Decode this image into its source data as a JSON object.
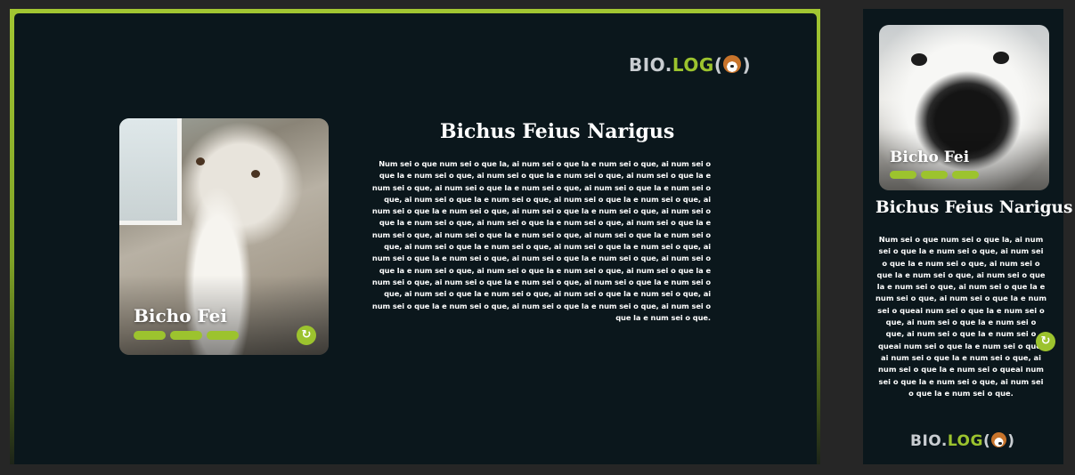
{
  "brand": {
    "bio": "BIO.",
    "log": "LOG",
    "open_paren": "(",
    "close_paren": ")",
    "emoji_icon": "dog-face-icon",
    "accent_color": "#9cc32e"
  },
  "desktop": {
    "card": {
      "pet_name": "Bicho Fei",
      "level_bars": 3,
      "refresh_icon": "refresh-icon"
    },
    "scientific_name": "Bichus Feius Narigus",
    "description": "Num sei o que num sei o que la, ai num sei o que la e num sei o que, ai num sei o que la e num sei o que, ai num sei o que la e num sei o que, ai num sei o que la e num sei o que, ai num sei o que la e num sei o que, ai num sei o que la e num sei o que, ai num sei o que la e num sei o que, ai num sei o que la e num sei o que, ai num sei o que la e num sei o que, ai num sei o que la e num sei o que, ai num sei o que la e num sei o que, ai num sei o que la e num sei o que, ai num sei o que la e num sei o que, ai num sei o que la e num sei o que, ai num sei o que la e num sei o que, ai num sei o que la e num sei o que, ai num sei o que la e num sei o que, ai num sei o que la e num sei o que, ai num sei o que la e num sei o que, ai num sei o que la e num sei o que, ai num sei o que la e num sei o que, ai num sei o que la e num sei o que, ai num sei o que la e num sei o que, ai num sei o que la e num sei o que, ai num sei o que la e num sei o que, ai num sei o que la e num sei o que, ai num sei o que la e num sei o que, ai num sei o que la e num sei o que, ai num sei o que la e num sei o que."
  },
  "mobile": {
    "card": {
      "pet_name": "Bicho Fei",
      "level_bars": 3,
      "refresh_icon": "refresh-icon"
    },
    "scientific_name": "Bichus Feius Narigus",
    "description": "Num sei o que num sei o que la, ai num sei o que la e num sei o que, ai num sei o que la e num sei o que, ai num sei o que la e num sei o que, ai num sei o que la e num sei o que, ai num sei o que la e num sei o que, ai num sei o que la e num sei o queai num sei o que la e num sei o que, ai num sei o que la e num sei o que,  ai num sei o que la e num sei o queai num sei o que la e num sei o que, ai num sei o que la e num sei o que,  ai num sei o que la e num sei o queai num sei o que la e num sei o que, ai num sei o que la e num sei o que."
  }
}
